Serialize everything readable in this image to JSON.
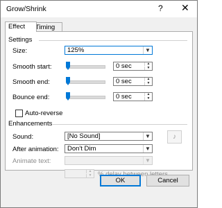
{
  "window": {
    "title": "Grow/Shrink",
    "help_glyph": "?",
    "close_glyph": "✕"
  },
  "tabs": [
    {
      "label": "Effect",
      "active": true
    },
    {
      "label": "Timing",
      "active": false
    }
  ],
  "settings": {
    "header": "Settings",
    "size": {
      "label": "Size:",
      "value": "125%"
    },
    "smooth_start": {
      "label": "Smooth start:",
      "value": "0 sec",
      "level": 0
    },
    "smooth_end": {
      "label": "Smooth end:",
      "value": "0 sec",
      "level": 0
    },
    "bounce_end": {
      "label": "Bounce end:",
      "value": "0 sec",
      "level": 0
    },
    "auto_reverse": {
      "label": "Auto-reverse",
      "checked": false
    }
  },
  "enhancements": {
    "header": "Enhancements",
    "sound": {
      "label": "Sound:",
      "value": "[No Sound]"
    },
    "after_animation": {
      "label": "After animation:",
      "value": "Don't Dim"
    },
    "animate_text": {
      "label": "Animate text:",
      "value": ""
    },
    "delay_suffix": "% delay between letters"
  },
  "buttons": {
    "ok": "OK",
    "cancel": "Cancel"
  },
  "colors": {
    "accent": "#0078d7",
    "dialog_bg": "#f0f0f0",
    "panel_bg": "#ffffff"
  }
}
